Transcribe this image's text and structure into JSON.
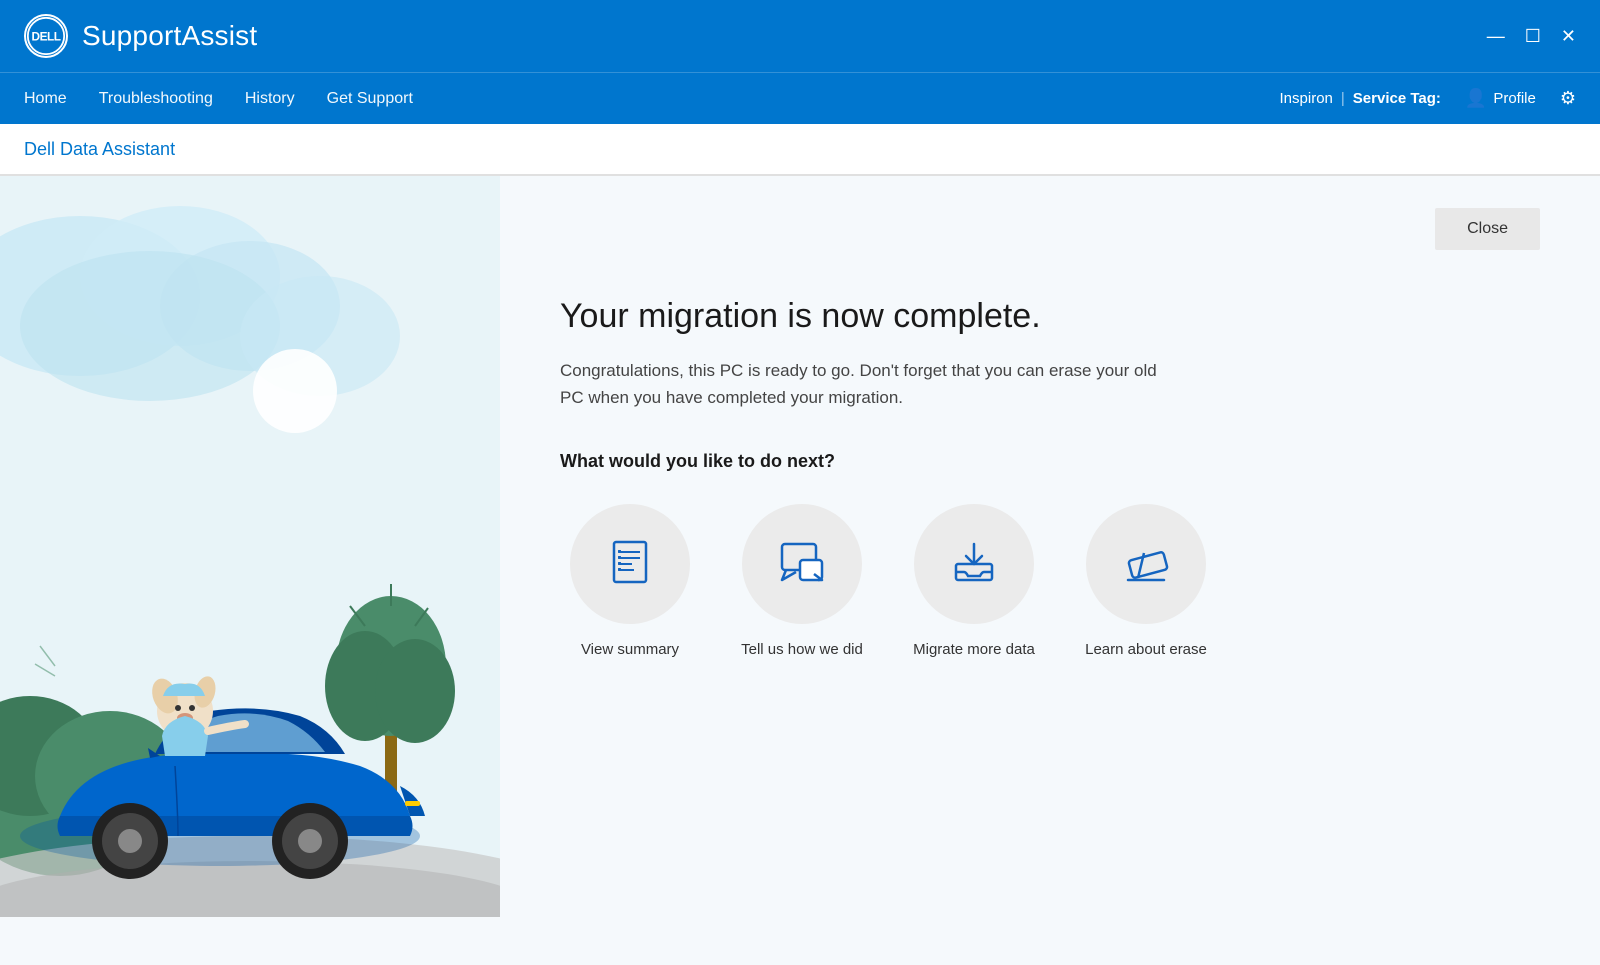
{
  "app": {
    "logo_text": "DELL",
    "title": "SupportAssist"
  },
  "window_controls": {
    "minimize": "—",
    "maximize": "☐",
    "close": "✕"
  },
  "nav": {
    "links": [
      "Home",
      "Troubleshooting",
      "History",
      "Get Support"
    ],
    "device": "Inspiron",
    "service_tag_label": "Service Tag:",
    "service_tag_value": "",
    "profile_label": "Profile"
  },
  "page_title": "Dell Data Assistant",
  "content": {
    "close_label": "Close",
    "heading": "Your migration is now complete.",
    "description": "Congratulations, this PC is ready to go. Don't forget that you can erase your old PC when you have completed your migration.",
    "next_label": "What would you like to do next?",
    "actions": [
      {
        "id": "view-summary",
        "label": "View summary"
      },
      {
        "id": "tell-us",
        "label": "Tell us how we did"
      },
      {
        "id": "migrate-more",
        "label": "Migrate more data"
      },
      {
        "id": "learn-erase",
        "label": "Learn about erase"
      }
    ]
  }
}
